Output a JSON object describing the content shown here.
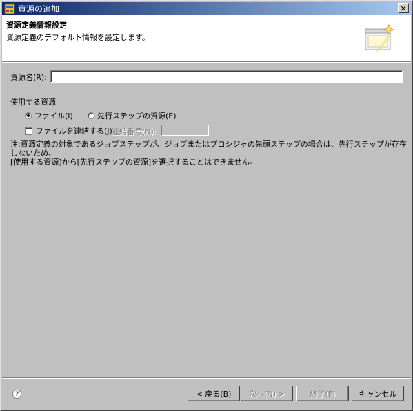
{
  "window": {
    "title": "資源の追加",
    "close_glyph": "✕"
  },
  "header": {
    "title": "資源定義情報設定",
    "description": "資源定義のデフォルト情報を設定します。"
  },
  "form": {
    "resource_name_label": "資源名(R):",
    "resource_name_value": "",
    "group_label": "使用する資源",
    "radio_file_label": "ファイル(I)",
    "radio_file_selected": true,
    "radio_prev_step_label": "先行ステップの資源(E)",
    "radio_prev_step_selected": false,
    "checkbox_concat_label": "ファイルを連結する(J)",
    "checkbox_concat_checked": false,
    "serial_label": "連結番号(N):",
    "serial_value": "",
    "note_line1": "注:資源定義の対象であるジョブステップが、ジョブまたはプロシジャの先頭ステップの場合は、先行ステップが存在しないため、",
    "note_line2": "[使用する資源]から[先行ステップの資源]を選択することはできません。"
  },
  "footer": {
    "help_glyph": "?",
    "back_label": "< 戻る(B)",
    "next_label": "次へ(N) >",
    "finish_label": "終了(F)",
    "cancel_label": "キャンセル"
  },
  "icons": {
    "app": "app-window-icon",
    "wizard": "wizard-banner-icon",
    "help": "help-icon"
  },
  "colors": {
    "titlebar_start": "#0a246a",
    "titlebar_end": "#a6caf0",
    "dialog_bg": "#c0c0c0",
    "disabled_text": "#808080"
  }
}
